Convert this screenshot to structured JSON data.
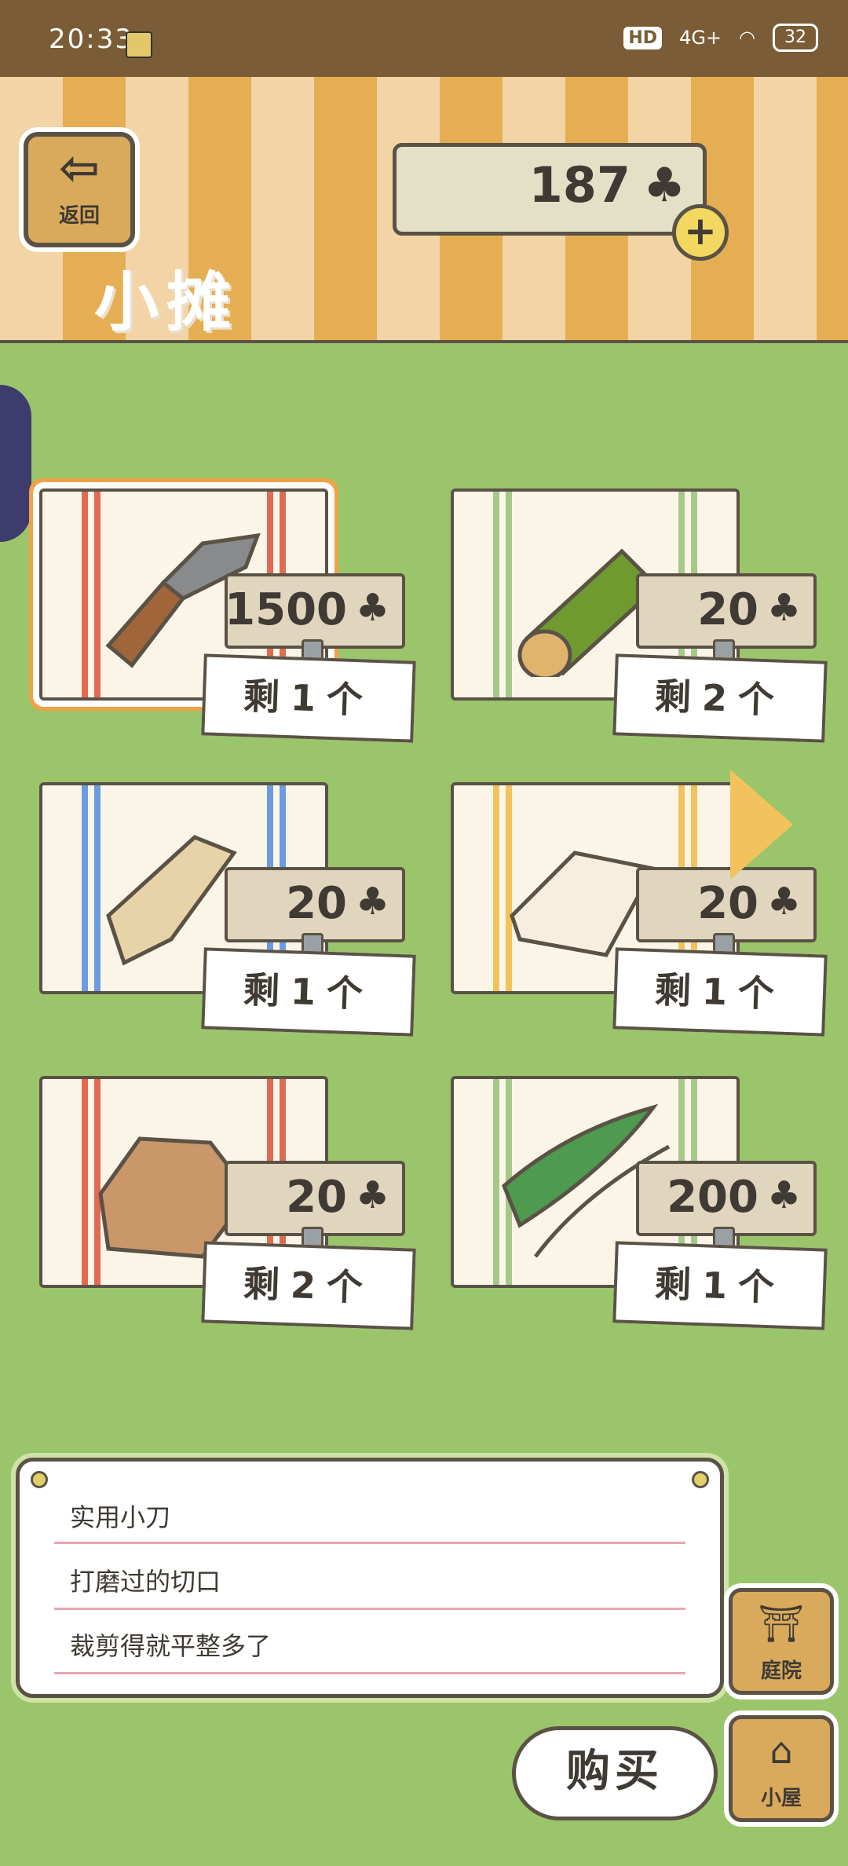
{
  "status": {
    "time": "20:33",
    "hd": "HD",
    "network": "4G+",
    "battery": "32"
  },
  "header": {
    "back_label": "返回",
    "title": "小摊",
    "currency": "187",
    "currency_icon": "clover-icon"
  },
  "items": [
    {
      "name": "实用小刀",
      "price": "1500",
      "stock": "剩1个"
    },
    {
      "name": "竹筒",
      "price": "20",
      "stock": "剩2个"
    },
    {
      "name": "树皮",
      "price": "20",
      "stock": "剩1个"
    },
    {
      "name": "布",
      "price": "20",
      "stock": "剩1个"
    },
    {
      "name": "纸袋",
      "price": "20",
      "stock": "剩2个"
    },
    {
      "name": "叶子",
      "price": "200",
      "stock": "剩1个"
    }
  ],
  "description": {
    "lines": [
      "实用小刀",
      "打磨过的切口",
      "裁剪得就平整多了"
    ]
  },
  "buttons": {
    "buy": "购买",
    "yard": "庭院",
    "house": "小屋"
  },
  "colors": {
    "grass": "#9bc56a",
    "wood": "#d9aa5c",
    "outline": "#5b5246",
    "highlight": "#f0a346"
  }
}
